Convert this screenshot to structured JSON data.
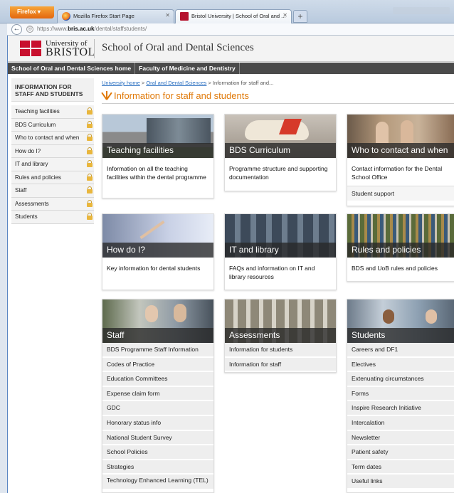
{
  "browser": {
    "menu_button": "Firefox",
    "tabs": [
      {
        "label": "Mozilla Firefox Start Page"
      },
      {
        "label": "Bristol University | School of Oral and ..."
      }
    ],
    "new_tab": "+",
    "url_prefix": "https://www.",
    "url_host": "bris.ac.uk",
    "url_path": "/dental/staffstudents/"
  },
  "header": {
    "uni_line1": "University of",
    "uni_line2": "BRISTOL",
    "school_name": "School of Oral and Dental Sciences",
    "brand_color": "#c8102e"
  },
  "site_nav": [
    "School of Oral and Dental Sciences home",
    "Faculty of Medicine and Dentistry"
  ],
  "sidebar": {
    "heading_line1": "INFORMATION FOR",
    "heading_line2": "STAFF AND STUDENTS",
    "items": [
      {
        "label": "Teaching facilities"
      },
      {
        "label": "BDS Curriculum"
      },
      {
        "label": "Who to contact and when"
      },
      {
        "label": "How do I?"
      },
      {
        "label": "IT and library"
      },
      {
        "label": "Rules and policies"
      },
      {
        "label": "Staff"
      },
      {
        "label": "Assessments"
      },
      {
        "label": "Students"
      }
    ]
  },
  "breadcrumb": {
    "home": "University home",
    "sep1": " > ",
    "section": "Oral and Dental Sciences",
    "sep2": " > ",
    "current": "Information for staff and..."
  },
  "page_title": "Information for staff and students",
  "accent_color": "#e07a0a",
  "cards": {
    "teaching": {
      "title": "Teaching facilities",
      "desc": "Information on all the teaching facilities within the dental programme"
    },
    "bds": {
      "title": "BDS Curriculum",
      "desc": "Programme structure and supporting documentation"
    },
    "contact": {
      "title": "Who to contact and when",
      "desc": "Contact information for the Dental School Office",
      "sublink": "Student support"
    },
    "howdoi": {
      "title": "How do I?",
      "desc": "Key information for dental students"
    },
    "it": {
      "title": "IT and library",
      "desc": "FAQs and information on IT and library resources"
    },
    "rules": {
      "title": "Rules and policies",
      "desc": "BDS and UoB rules and policies"
    },
    "staff": {
      "title": "Staff",
      "links": [
        "BDS Programme Staff Information",
        "Codes of Practice",
        "Education Committees",
        "Expense claim form",
        "GDC",
        "Honorary status info",
        "National Student Survey",
        "School Policies",
        "Strategies",
        "Technology Enhanced Learning (TEL)"
      ]
    },
    "assessments": {
      "title": "Assessments",
      "links": [
        "Information for students",
        "Information for staff"
      ]
    },
    "students": {
      "title": "Students",
      "links": [
        "Careers and DF1",
        "Electives",
        "Extenuating circumstances",
        "Forms",
        "Inspire Research Initiative",
        "Intercalation",
        "Newsletter",
        "Patient safety",
        "Term dates",
        "Useful links"
      ]
    }
  }
}
